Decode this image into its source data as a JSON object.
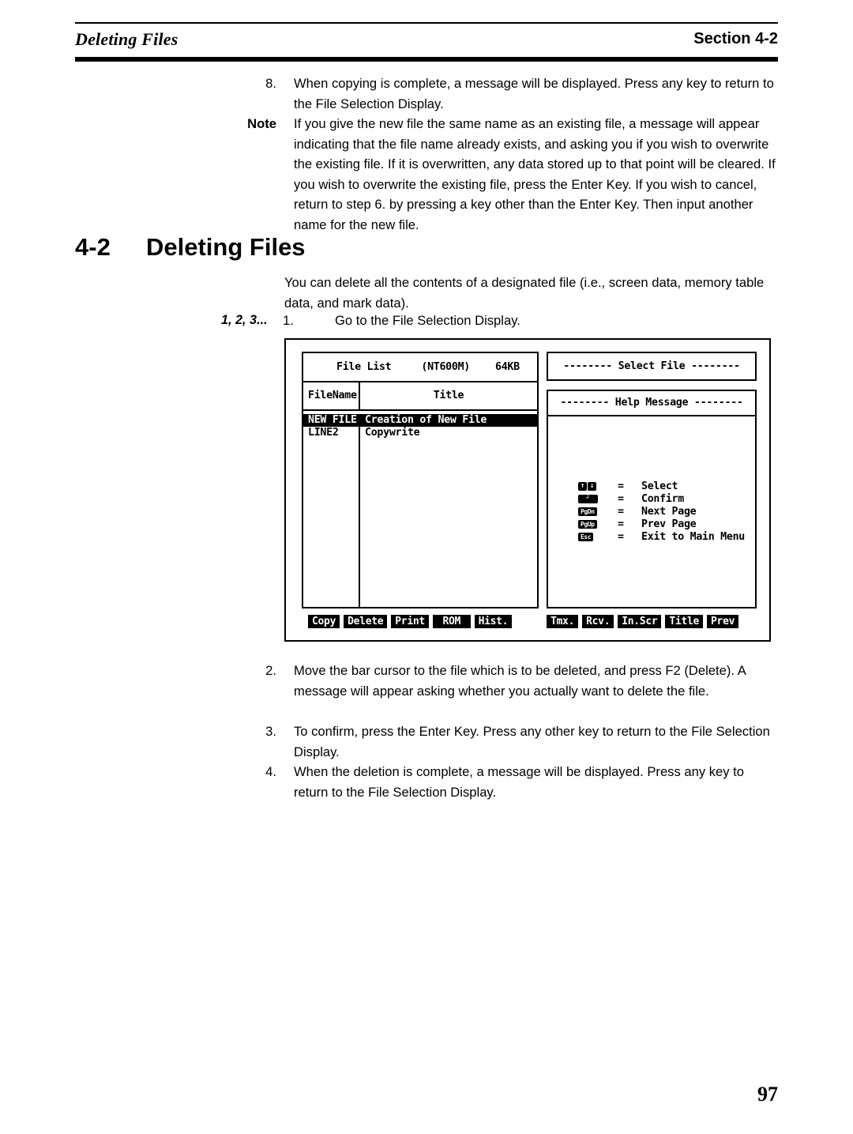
{
  "header": {
    "left_title": "Deleting Files",
    "section_word": "Section",
    "section_number": "4-2"
  },
  "steps_top": {
    "step8": {
      "label": "8.",
      "text": "When copying is complete, a message will be displayed. Press any key to return to the File Selection Display."
    },
    "note": {
      "label": "Note",
      "text": "If you give the new file the same name as an existing file, a message will appear indicating that the file name already exists, and asking you if you wish to overwrite the existing file. If it is overwritten, any data stored up to that point will be cleared. If you wish to overwrite the existing file, press the Enter Key. If you wish to cancel, return to step 6. by pressing a key other than the Enter Key. Then input another name for the new file."
    }
  },
  "section": {
    "number": "4-2",
    "title": "Deleting Files",
    "intro": "You can delete all the contents of a designated file (i.e., screen data, memory table data, and mark data)."
  },
  "step1": {
    "marker": "1, 2, 3...",
    "label": "1.",
    "text": "Go to the File Selection Display."
  },
  "screen": {
    "file_list": {
      "title": "File List",
      "model": "(NT600M)",
      "size": "64KB",
      "columns": {
        "filename": "FileName",
        "title": "Title"
      },
      "rows": [
        {
          "filename": "NEW FILE",
          "title": "Creation of New File",
          "selected": true
        },
        {
          "filename": "LINE2",
          "title": "Copywrite",
          "selected": false
        }
      ]
    },
    "select_file_banner": "-------- Select File --------",
    "help_message_banner": "-------- Help Message --------",
    "help_keys": [
      {
        "glyphs": [
          "↑",
          "↓"
        ],
        "type": "arrows",
        "eq": "=",
        "desc": "Select"
      },
      {
        "glyphs": [
          "┘"
        ],
        "type": "enter",
        "eq": "=",
        "desc": "Confirm"
      },
      {
        "glyphs": [
          "PgDn"
        ],
        "type": "word",
        "eq": "=",
        "desc": "Next Page"
      },
      {
        "glyphs": [
          "PgUp"
        ],
        "type": "word",
        "eq": "=",
        "desc": "Prev Page"
      },
      {
        "glyphs": [
          "Esc"
        ],
        "type": "word",
        "eq": "=",
        "desc": "Exit to Main Menu"
      }
    ],
    "function_keys_left": [
      "Copy",
      "Delete",
      "Print",
      " ROM ",
      "Hist."
    ],
    "function_keys_right": [
      "Tmx.",
      "Rcv.",
      "In.Scr",
      "Title",
      "Prev"
    ]
  },
  "steps_bottom": {
    "step2": {
      "label": "2.",
      "text": "Move the bar cursor to the file which is to be deleted, and press F2 (Delete). A message will appear asking whether you actually want to delete the file."
    },
    "step3": {
      "label": "3.",
      "text": "To confirm, press the Enter Key. Press any other key to return to the File Selection Display."
    },
    "step4": {
      "label": "4.",
      "text": "When the deletion is complete, a message will be displayed. Press any key to return to the File Selection Display."
    }
  },
  "footer": {
    "page_number": "97"
  }
}
